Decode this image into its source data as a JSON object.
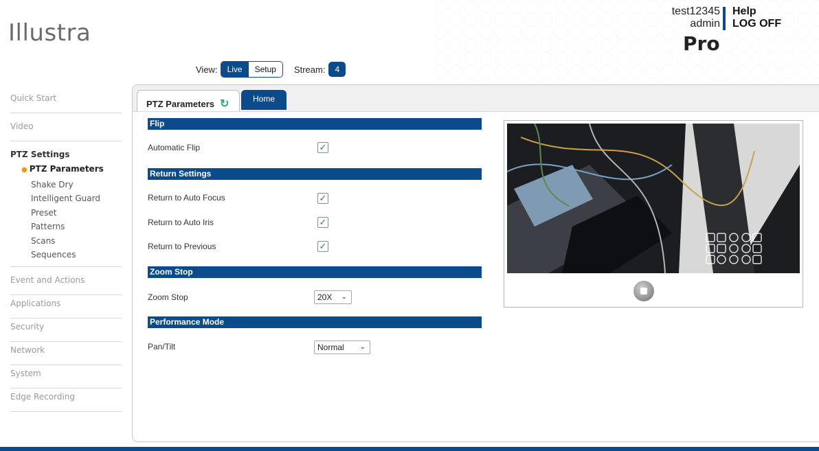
{
  "header": {
    "logo": "Illustra",
    "username": "test12345",
    "role": "admin",
    "help": "Help",
    "logoff": "LOG OFF",
    "edition": "Pro"
  },
  "viewbar": {
    "view_label": "View:",
    "live": "Live",
    "setup": "Setup",
    "stream_label": "Stream:",
    "stream_value": "4"
  },
  "sidebar": {
    "items_top": [
      "Quick Start",
      "Video"
    ],
    "ptz_group": "PTZ Settings",
    "ptz_sub": [
      "PTZ Parameters",
      "Shake Dry",
      "Intelligent Guard",
      "Preset",
      "Patterns",
      "Scans",
      "Sequences"
    ],
    "items_bottom": [
      "Event and Actions",
      "Applications",
      "Security",
      "Network",
      "System",
      "Edge Recording"
    ]
  },
  "tabs": {
    "active": "PTZ Parameters",
    "home": "Home"
  },
  "form": {
    "flip_section": "Flip",
    "automatic_flip": "Automatic Flip",
    "return_section": "Return Settings",
    "return_auto_focus": "Return to Auto Focus",
    "return_auto_iris": "Return to Auto Iris",
    "return_previous": "Return to Previous",
    "zoom_section": "Zoom Stop",
    "zoom_stop_label": "Zoom Stop",
    "zoom_stop_value": "20X",
    "perf_section": "Performance Mode",
    "pan_tilt_label": "Pan/Tilt",
    "pan_tilt_value": "Normal"
  },
  "colors": {
    "accent": "#0b4a8b",
    "refresh": "#2aa97a",
    "bullet": "#e89b1a"
  }
}
